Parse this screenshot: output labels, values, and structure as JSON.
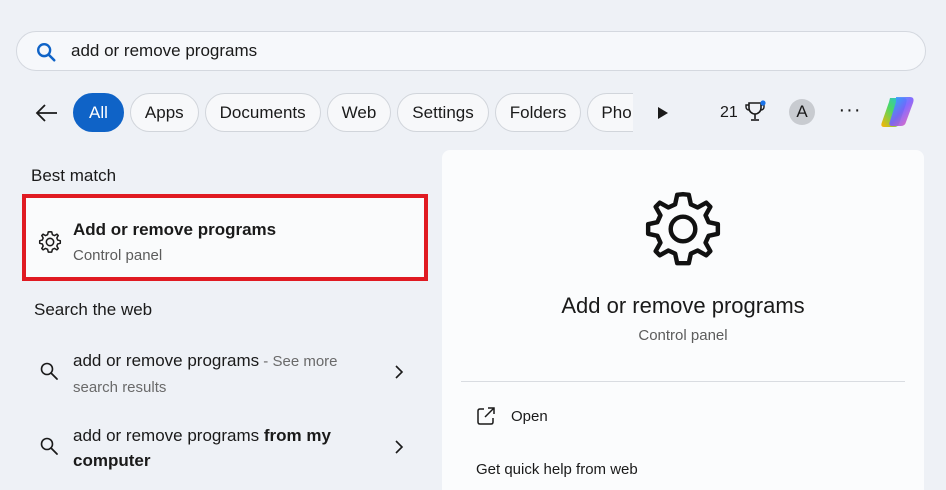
{
  "search": {
    "query": "add or remove programs"
  },
  "filters": [
    "All",
    "Apps",
    "Documents",
    "Web",
    "Settings",
    "Folders",
    "Pho"
  ],
  "header": {
    "points": "21",
    "avatar_letter": "A",
    "more": "···"
  },
  "best_match": {
    "heading": "Best match",
    "title": "Add or remove programs",
    "subtitle": "Control panel"
  },
  "web": {
    "heading": "Search the web",
    "items": [
      {
        "main": "add or remove programs",
        "suffix": " - See more search results",
        "bold_suffix": ""
      },
      {
        "main": "add or remove programs ",
        "suffix": "",
        "bold_suffix": "from my computer"
      }
    ]
  },
  "preview": {
    "title": "Add or remove programs",
    "subtitle": "Control panel",
    "actions": {
      "open": "Open",
      "help": "Get quick help from web"
    }
  },
  "colors": {
    "accent": "#0f63c7",
    "highlight_border": "#e01a22"
  }
}
